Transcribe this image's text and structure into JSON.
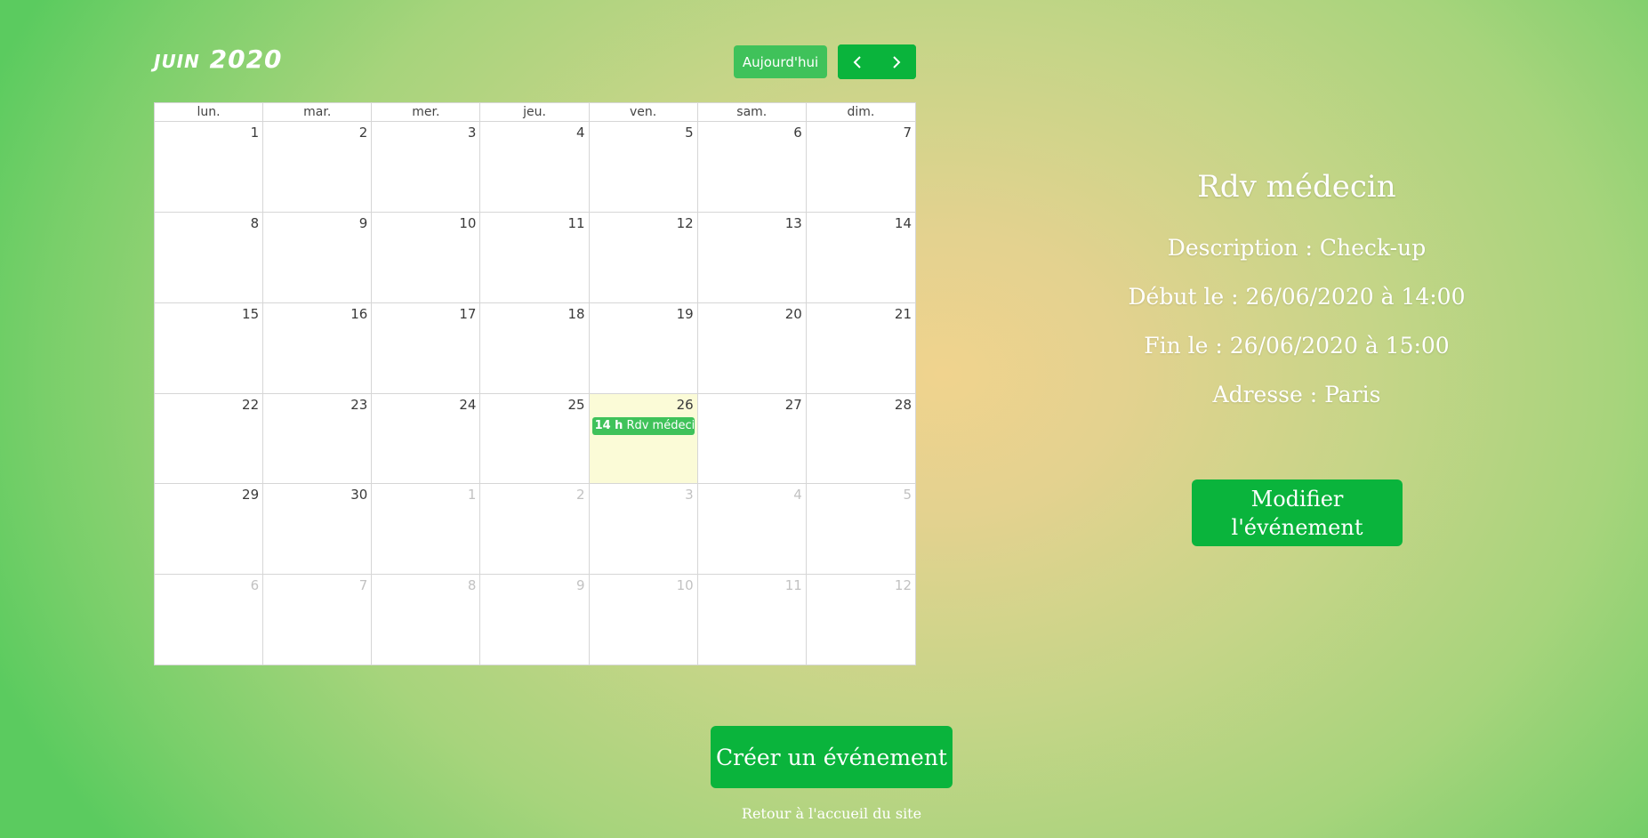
{
  "calendar": {
    "title": "juin 2020",
    "today_label": "Aujourd'hui",
    "prev_icon": "chevron-left-icon",
    "next_icon": "chevron-right-icon",
    "weekdays": [
      "lun.",
      "mar.",
      "mer.",
      "jeu.",
      "ven.",
      "sam.",
      "dim."
    ],
    "weeks": [
      [
        {
          "n": "1"
        },
        {
          "n": "2"
        },
        {
          "n": "3"
        },
        {
          "n": "4"
        },
        {
          "n": "5"
        },
        {
          "n": "6"
        },
        {
          "n": "7"
        }
      ],
      [
        {
          "n": "8"
        },
        {
          "n": "9"
        },
        {
          "n": "10"
        },
        {
          "n": "11"
        },
        {
          "n": "12"
        },
        {
          "n": "13"
        },
        {
          "n": "14"
        }
      ],
      [
        {
          "n": "15"
        },
        {
          "n": "16"
        },
        {
          "n": "17"
        },
        {
          "n": "18"
        },
        {
          "n": "19"
        },
        {
          "n": "20"
        },
        {
          "n": "21"
        }
      ],
      [
        {
          "n": "22"
        },
        {
          "n": "23"
        },
        {
          "n": "24"
        },
        {
          "n": "25"
        },
        {
          "n": "26",
          "today": true,
          "event": {
            "time": "14 h",
            "title": "Rdv médecin"
          }
        },
        {
          "n": "27"
        },
        {
          "n": "28"
        }
      ],
      [
        {
          "n": "29"
        },
        {
          "n": "30"
        },
        {
          "n": "1",
          "other": true
        },
        {
          "n": "2",
          "other": true
        },
        {
          "n": "3",
          "other": true
        },
        {
          "n": "4",
          "other": true
        },
        {
          "n": "5",
          "other": true
        }
      ],
      [
        {
          "n": "6",
          "other": true
        },
        {
          "n": "7",
          "other": true
        },
        {
          "n": "8",
          "other": true
        },
        {
          "n": "9",
          "other": true
        },
        {
          "n": "10",
          "other": true
        },
        {
          "n": "11",
          "other": true
        },
        {
          "n": "12",
          "other": true
        }
      ]
    ]
  },
  "event_details": {
    "title": "Rdv médecin",
    "description": "Description : Check-up",
    "start": "Début le : 26/06/2020 à 14:00",
    "end": "Fin le : 26/06/2020 à 15:00",
    "address": "Adresse : Paris",
    "edit_label": "Modifier l'événement"
  },
  "actions": {
    "create_label": "Créer un événement",
    "back_label": "Retour à l'accueil du site"
  },
  "colors": {
    "accent": "#0ab43c",
    "accent_light": "#3fc25a",
    "today_bg": "#fbfbd7"
  }
}
